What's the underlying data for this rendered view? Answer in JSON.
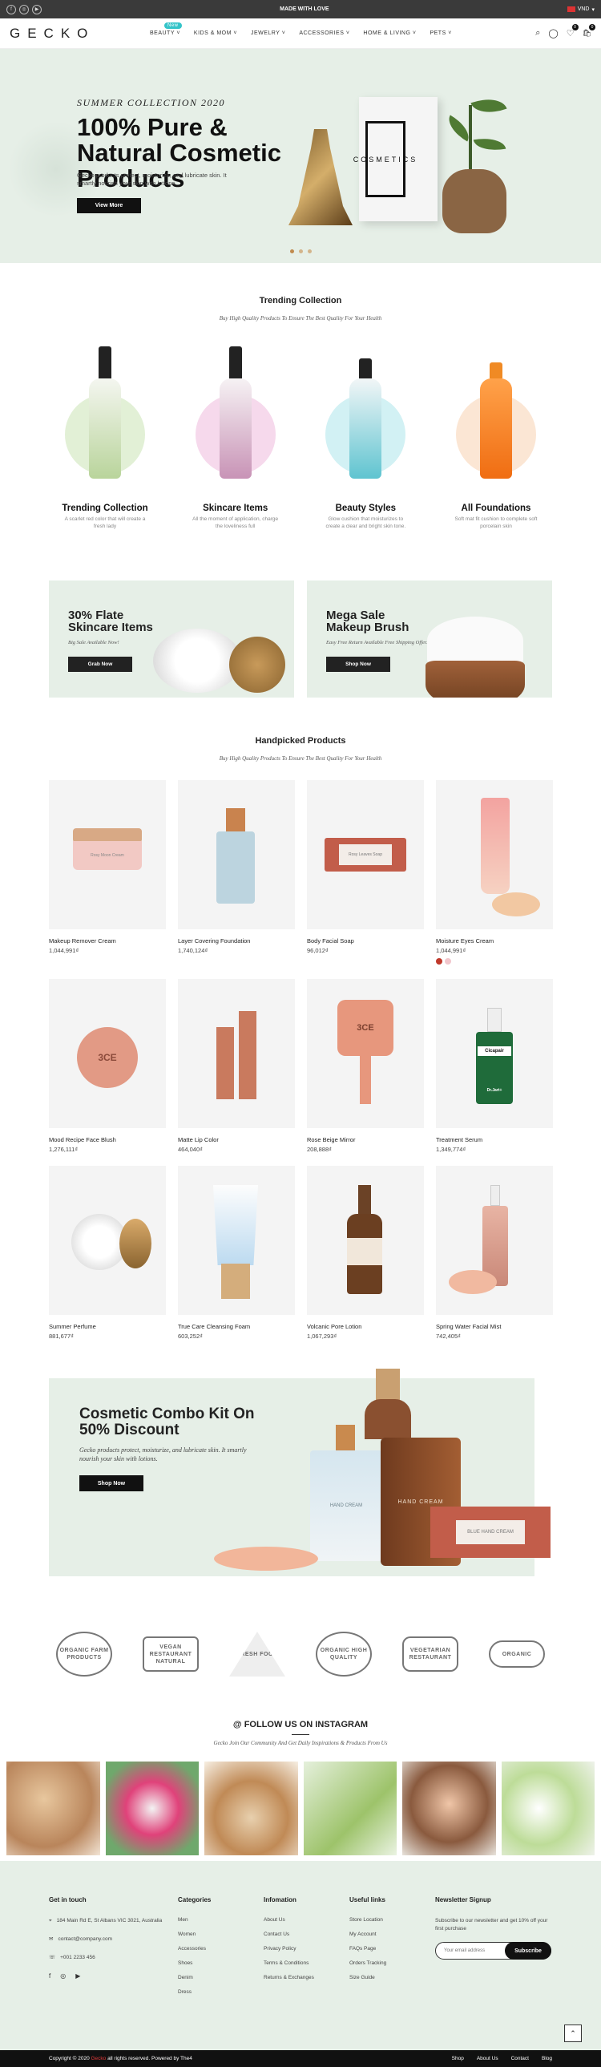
{
  "topbar": {
    "announcement": "MADE WITH LOVE",
    "currency": "VND",
    "currency_caret": "▾",
    "socials": [
      "f",
      "◎",
      "▶"
    ]
  },
  "header": {
    "logo": "GECKO",
    "nav": [
      {
        "label": "BEAUTY ˅",
        "badge": "New"
      },
      {
        "label": "KIDS & MOM ˅"
      },
      {
        "label": "JEWELRY ˅"
      },
      {
        "label": "ACCESSORIES ˅"
      },
      {
        "label": "HOME & LIVING ˅"
      },
      {
        "label": "PETS ˅"
      }
    ],
    "icons": {
      "search": "⌕",
      "account": "◯",
      "wishlist": "♡",
      "cart": "🛍"
    },
    "wishlist_count": "0",
    "cart_count": "0"
  },
  "hero": {
    "subtitle": "SUMMER COLLECTION 2020",
    "title": "100% Pure & Natural Cosmetic Products",
    "text": "Gecko products protect, moisturize, and lubricate skin. It smartly nourish your skin with lotions.",
    "button": "View More",
    "box_text": "COSMETICS"
  },
  "trending": {
    "title": "Trending Collection",
    "subtitle": "Buy High Quality Products To Ensure The Best Quality For Your Health",
    "items": [
      {
        "title": "Trending Collection",
        "text": "A scarlet red color that will create a fresh lady"
      },
      {
        "title": "Skincare Items",
        "text": "All the moment of application, charge the loveliness full"
      },
      {
        "title": "Beauty Styles",
        "text": "Glow cushion that moisturizes to create a clear and bright skin tone."
      },
      {
        "title": "All Foundations",
        "text": "Soft mat fit cushion to complete soft porcelain skin"
      }
    ]
  },
  "promos": [
    {
      "title": "30% Flate Skincare Items",
      "text": "Big Sale Available Now!",
      "button": "Grab Now"
    },
    {
      "title": "Mega Sale Makeup Brush",
      "text": "Easy Free Return Available Free Shipping Offer.",
      "button": "Shop Now"
    }
  ],
  "handpicked": {
    "title": "Handpicked Products",
    "subtitle": "Buy High Quality Products To Ensure The Best Quality For Your Health",
    "products": [
      {
        "name": "Makeup Remover Cream",
        "price": "1,044,991₫"
      },
      {
        "name": "Layer Covering Foundation",
        "price": "1,740,124₫"
      },
      {
        "name": "Body Facial Soap",
        "price": "96,012₫"
      },
      {
        "name": "Moisture Eyes Cream",
        "price": "1,044,991₫"
      },
      {
        "name": "Mood Recipe Face Blush",
        "price": "1,276,111₫"
      },
      {
        "name": "Matte Lip Color",
        "price": "464,040₫"
      },
      {
        "name": "Rose Beige Mirror",
        "price": "208,888₫"
      },
      {
        "name": "Treatment Serum",
        "price": "1,349,774₫"
      },
      {
        "name": "Summer Perfume",
        "price": "881,677₫"
      },
      {
        "name": "True Care Cleansing Foam",
        "price": "603,252₫"
      },
      {
        "name": "Volcanic Pore Lotion",
        "price": "1,067,293₫"
      },
      {
        "name": "Spring Water Facial Mist",
        "price": "742,405₫"
      }
    ],
    "swatch_colors": [
      "#c0392b",
      "#f1c6cc"
    ],
    "product_labels": {
      "remover": "Rosy Moon Cream",
      "soap": "Rosy Leaves Soap",
      "blush_brand": "3CE",
      "serum_brand": "Cicapair",
      "serum_maker": "Dr.Jart+"
    }
  },
  "combo": {
    "title": "Cosmetic Combo Kit On 50% Discount",
    "text": "Gecko products protect, moisturize, and lubricate skin. It smartly nourish your skin with lotions.",
    "button": "Shop Now",
    "jar_label": "HAND CREAM",
    "soap_label": "BLUE HAND CREAM",
    "tube_label": "HAND CREAM"
  },
  "brands": [
    "ORGANIC FARM PRODUCTS",
    "VEGAN RESTAURANT NATURAL",
    "FRESH FOOD",
    "ORGANIC HIGH QUALITY",
    "VEGETARIAN RESTAURANT",
    "ORGANIC"
  ],
  "instagram": {
    "title": "@ FOLLOW US ON INSTAGRAM",
    "subtitle": "Gecko Join Our Community And Get Daily Inspirations & Products From Us"
  },
  "footer": {
    "contact_title": "Get in touch",
    "address": "184 Main Rd E, St Albans VIC 3021, Australia",
    "email": "contact@company.com",
    "phone": "+001 2233 456",
    "contact_icons": {
      "address": "⌖",
      "email": "✉",
      "phone": "☏"
    },
    "socials": [
      "f",
      "◎",
      "▶"
    ],
    "categories_title": "Categories",
    "categories": [
      "Men",
      "Women",
      "Accessories",
      "Shoes",
      "Denim",
      "Dress"
    ],
    "info_title": "Infomation",
    "info": [
      "About Us",
      "Contact Us",
      "Privacy Policy",
      "Terms & Conditions",
      "Returns & Exchanges"
    ],
    "useful_title": "Useful links",
    "useful": [
      "Store Location",
      "My Account",
      "FAQs Page",
      "Orders Tracking",
      "Size Guide"
    ],
    "newsletter_title": "Newsletter Signup",
    "newsletter_text": "Subscribe to our newsletter and get 10% off your first purchase",
    "newsletter_placeholder": "Your email address",
    "newsletter_button": "Subscribe",
    "to_top": "⌃"
  },
  "bottom": {
    "copyright_prefix": "Copyright © 2020",
    "brand": "Gecko",
    "copyright_suffix": "all rights reserved. Powered by The4",
    "links": [
      "Shop",
      "About Us",
      "Contact",
      "Blog"
    ]
  }
}
